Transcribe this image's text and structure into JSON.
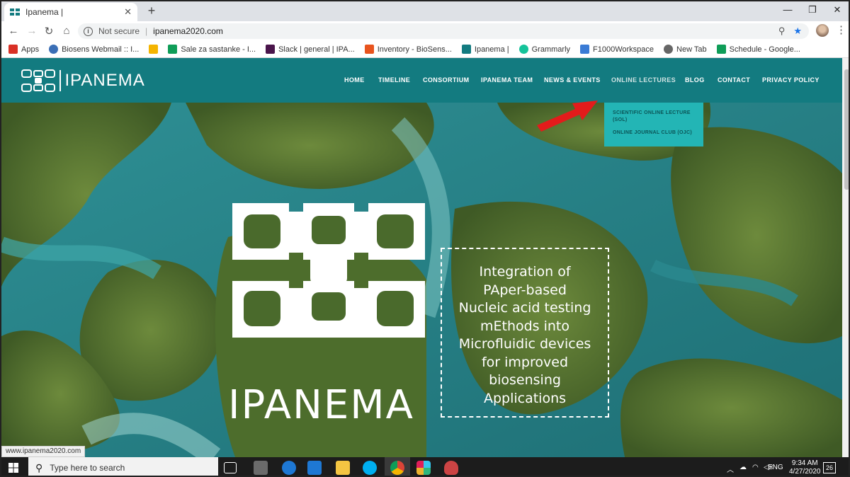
{
  "browser": {
    "tab_title": "Ipanema |",
    "omnibox_security": "Not secure",
    "url": "ipanema2020.com"
  },
  "bookmarks": [
    {
      "label": "Apps",
      "icon": "apps-grid-icon",
      "color": "#d93025"
    },
    {
      "label": "Biosens Webmail :: I...",
      "icon": "webmail-icon",
      "color": "#3b6fb6"
    },
    {
      "label": "",
      "icon": "google-drive-icon",
      "color": "#f4b400"
    },
    {
      "label": "Sale za sastanke - I...",
      "icon": "sheets-icon",
      "color": "#0f9d58"
    },
    {
      "label": "Slack | general | IPA...",
      "icon": "slack-icon",
      "color": "#4a154b"
    },
    {
      "label": "Inventory - BioSens...",
      "icon": "inventory-icon",
      "color": "#e8541e"
    },
    {
      "label": "Ipanema |",
      "icon": "ipanema-icon",
      "color": "#137b80"
    },
    {
      "label": "Grammarly",
      "icon": "grammarly-icon",
      "color": "#15c39a"
    },
    {
      "label": "F1000Workspace",
      "icon": "f1000-icon",
      "color": "#3a7bd5"
    },
    {
      "label": "New Tab",
      "icon": "globe-icon",
      "color": "#666666"
    },
    {
      "label": "Schedule - Google...",
      "icon": "sheets-icon",
      "color": "#0f9d58"
    }
  ],
  "site": {
    "logo_text": "IPANEMA",
    "nav": [
      "HOME",
      "TIMELINE",
      "CONSORTIUM",
      "IPANEMA TEAM",
      "NEWS & EVENTS",
      "ONLINE LECTURES",
      "BLOG",
      "CONTACT",
      "PRIVACY POLICY"
    ],
    "active_nav": "ONLINE LECTURES",
    "dropdown": [
      "SCIENTIFIC ONLINE LECTURE (SOL)",
      "ONLINE JOURNAL CLUB (OJC)"
    ],
    "hero_wordmark": "IPANEMA",
    "tagline_lines": [
      "Integration of",
      "PAper-based",
      "Nucleic acid testing",
      "mEthods into",
      "Microfluidic devices",
      "for improved",
      "biosensing",
      "Applications"
    ],
    "status_url": "www.ipanema2020.com",
    "colors": {
      "header": "#137b80",
      "dropdown": "#23b5b5",
      "arrow": "#e31b1b"
    }
  },
  "taskbar": {
    "search_placeholder": "Type here to search",
    "language": "ENG",
    "time": "9:34 AM",
    "date": "4/27/2020",
    "notifications": "26"
  }
}
